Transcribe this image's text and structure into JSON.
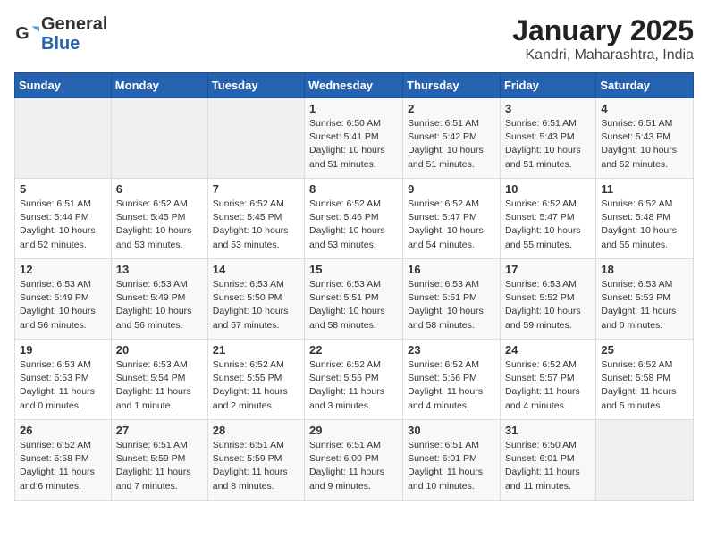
{
  "logo": {
    "line1": "General",
    "line2": "Blue"
  },
  "title": "January 2025",
  "location": "Kandri, Maharashtra, India",
  "weekdays": [
    "Sunday",
    "Monday",
    "Tuesday",
    "Wednesday",
    "Thursday",
    "Friday",
    "Saturday"
  ],
  "weeks": [
    [
      {
        "day": "",
        "info": ""
      },
      {
        "day": "",
        "info": ""
      },
      {
        "day": "",
        "info": ""
      },
      {
        "day": "1",
        "info": "Sunrise: 6:50 AM\nSunset: 5:41 PM\nDaylight: 10 hours\nand 51 minutes."
      },
      {
        "day": "2",
        "info": "Sunrise: 6:51 AM\nSunset: 5:42 PM\nDaylight: 10 hours\nand 51 minutes."
      },
      {
        "day": "3",
        "info": "Sunrise: 6:51 AM\nSunset: 5:43 PM\nDaylight: 10 hours\nand 51 minutes."
      },
      {
        "day": "4",
        "info": "Sunrise: 6:51 AM\nSunset: 5:43 PM\nDaylight: 10 hours\nand 52 minutes."
      }
    ],
    [
      {
        "day": "5",
        "info": "Sunrise: 6:51 AM\nSunset: 5:44 PM\nDaylight: 10 hours\nand 52 minutes."
      },
      {
        "day": "6",
        "info": "Sunrise: 6:52 AM\nSunset: 5:45 PM\nDaylight: 10 hours\nand 53 minutes."
      },
      {
        "day": "7",
        "info": "Sunrise: 6:52 AM\nSunset: 5:45 PM\nDaylight: 10 hours\nand 53 minutes."
      },
      {
        "day": "8",
        "info": "Sunrise: 6:52 AM\nSunset: 5:46 PM\nDaylight: 10 hours\nand 53 minutes."
      },
      {
        "day": "9",
        "info": "Sunrise: 6:52 AM\nSunset: 5:47 PM\nDaylight: 10 hours\nand 54 minutes."
      },
      {
        "day": "10",
        "info": "Sunrise: 6:52 AM\nSunset: 5:47 PM\nDaylight: 10 hours\nand 55 minutes."
      },
      {
        "day": "11",
        "info": "Sunrise: 6:52 AM\nSunset: 5:48 PM\nDaylight: 10 hours\nand 55 minutes."
      }
    ],
    [
      {
        "day": "12",
        "info": "Sunrise: 6:53 AM\nSunset: 5:49 PM\nDaylight: 10 hours\nand 56 minutes."
      },
      {
        "day": "13",
        "info": "Sunrise: 6:53 AM\nSunset: 5:49 PM\nDaylight: 10 hours\nand 56 minutes."
      },
      {
        "day": "14",
        "info": "Sunrise: 6:53 AM\nSunset: 5:50 PM\nDaylight: 10 hours\nand 57 minutes."
      },
      {
        "day": "15",
        "info": "Sunrise: 6:53 AM\nSunset: 5:51 PM\nDaylight: 10 hours\nand 58 minutes."
      },
      {
        "day": "16",
        "info": "Sunrise: 6:53 AM\nSunset: 5:51 PM\nDaylight: 10 hours\nand 58 minutes."
      },
      {
        "day": "17",
        "info": "Sunrise: 6:53 AM\nSunset: 5:52 PM\nDaylight: 10 hours\nand 59 minutes."
      },
      {
        "day": "18",
        "info": "Sunrise: 6:53 AM\nSunset: 5:53 PM\nDaylight: 11 hours\nand 0 minutes."
      }
    ],
    [
      {
        "day": "19",
        "info": "Sunrise: 6:53 AM\nSunset: 5:53 PM\nDaylight: 11 hours\nand 0 minutes."
      },
      {
        "day": "20",
        "info": "Sunrise: 6:53 AM\nSunset: 5:54 PM\nDaylight: 11 hours\nand 1 minute."
      },
      {
        "day": "21",
        "info": "Sunrise: 6:52 AM\nSunset: 5:55 PM\nDaylight: 11 hours\nand 2 minutes."
      },
      {
        "day": "22",
        "info": "Sunrise: 6:52 AM\nSunset: 5:55 PM\nDaylight: 11 hours\nand 3 minutes."
      },
      {
        "day": "23",
        "info": "Sunrise: 6:52 AM\nSunset: 5:56 PM\nDaylight: 11 hours\nand 4 minutes."
      },
      {
        "day": "24",
        "info": "Sunrise: 6:52 AM\nSunset: 5:57 PM\nDaylight: 11 hours\nand 4 minutes."
      },
      {
        "day": "25",
        "info": "Sunrise: 6:52 AM\nSunset: 5:58 PM\nDaylight: 11 hours\nand 5 minutes."
      }
    ],
    [
      {
        "day": "26",
        "info": "Sunrise: 6:52 AM\nSunset: 5:58 PM\nDaylight: 11 hours\nand 6 minutes."
      },
      {
        "day": "27",
        "info": "Sunrise: 6:51 AM\nSunset: 5:59 PM\nDaylight: 11 hours\nand 7 minutes."
      },
      {
        "day": "28",
        "info": "Sunrise: 6:51 AM\nSunset: 5:59 PM\nDaylight: 11 hours\nand 8 minutes."
      },
      {
        "day": "29",
        "info": "Sunrise: 6:51 AM\nSunset: 6:00 PM\nDaylight: 11 hours\nand 9 minutes."
      },
      {
        "day": "30",
        "info": "Sunrise: 6:51 AM\nSunset: 6:01 PM\nDaylight: 11 hours\nand 10 minutes."
      },
      {
        "day": "31",
        "info": "Sunrise: 6:50 AM\nSunset: 6:01 PM\nDaylight: 11 hours\nand 11 minutes."
      },
      {
        "day": "",
        "info": ""
      }
    ]
  ]
}
